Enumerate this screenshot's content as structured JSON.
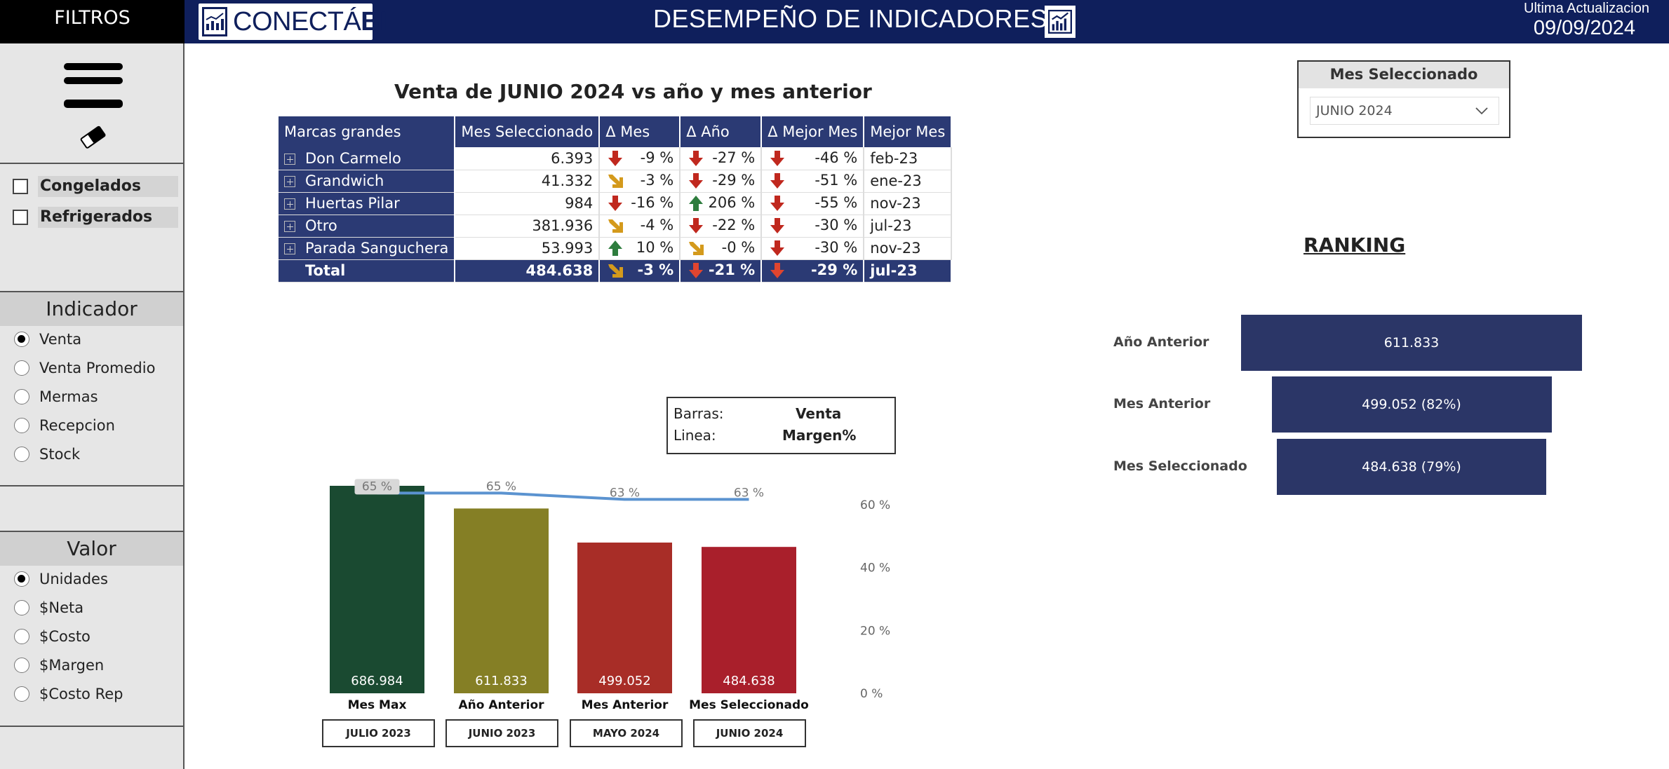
{
  "sidebar": {
    "header": "FILTROS",
    "checkboxes": [
      {
        "label": "Congelados",
        "checked": false
      },
      {
        "label": "Refrigerados",
        "checked": false
      }
    ],
    "indicador": {
      "title": "Indicador",
      "options": [
        "Venta",
        "Venta Promedio",
        "Mermas",
        "Recepcion",
        "Stock"
      ],
      "selected": "Venta"
    },
    "valor": {
      "title": "Valor",
      "options": [
        "Unidades",
        "$Neta",
        "$Costo",
        "$Margen",
        "$Costo Rep"
      ],
      "selected": "Unidades"
    }
  },
  "header": {
    "logo_text_light": "CONECTÁ",
    "logo_text_bold": "BI",
    "title": "DESEMPEÑO DE INDICADORES",
    "update_label": "Ultima Actualizacion",
    "update_date": "09/09/2024"
  },
  "table": {
    "title": "Venta de JUNIO 2024 vs año y mes anterior",
    "columns": [
      "Marcas grandes",
      "Mes Seleccionado",
      "Δ Mes",
      "Δ Año",
      "Δ Mejor Mes",
      "Mejor Mes"
    ],
    "rows": [
      {
        "brand": "Don Carmelo",
        "mes": "6.393",
        "d_mes": "-9 %",
        "d_mes_icon": "down",
        "d_ano": "-27 %",
        "d_ano_icon": "down",
        "d_mejor": "-46 %",
        "d_mejor_icon": "down",
        "mejor_mes": "feb-23"
      },
      {
        "brand": "Grandwich",
        "mes": "41.332",
        "d_mes": "-3 %",
        "d_mes_icon": "diag",
        "d_ano": "-29 %",
        "d_ano_icon": "down",
        "d_mejor": "-51 %",
        "d_mejor_icon": "down",
        "mejor_mes": "ene-23"
      },
      {
        "brand": "Huertas Pilar",
        "mes": "984",
        "d_mes": "-16 %",
        "d_mes_icon": "down",
        "d_ano": "206 %",
        "d_ano_icon": "up",
        "d_mejor": "-55 %",
        "d_mejor_icon": "down",
        "mejor_mes": "nov-23"
      },
      {
        "brand": "Otro",
        "mes": "381.936",
        "d_mes": "-4 %",
        "d_mes_icon": "diag",
        "d_ano": "-22 %",
        "d_ano_icon": "down",
        "d_mejor": "-30 %",
        "d_mejor_icon": "down",
        "mejor_mes": "jul-23"
      },
      {
        "brand": "Parada Sanguchera",
        "mes": "53.993",
        "d_mes": "10 %",
        "d_mes_icon": "up",
        "d_ano": "-0 %",
        "d_ano_icon": "diag",
        "d_mejor": "-30 %",
        "d_mejor_icon": "down",
        "mejor_mes": "nov-23"
      }
    ],
    "total": {
      "brand": "Total",
      "mes": "484.638",
      "d_mes": "-3 %",
      "d_mes_icon": "diag",
      "d_ano": "-21 %",
      "d_ano_icon": "down_light",
      "d_mejor": "-29 %",
      "d_mejor_icon": "down_light",
      "mejor_mes": "jul-23"
    }
  },
  "icon_colors": {
    "down": "#c0281e",
    "up": "#2e7d3e",
    "diag": "#d49a1c",
    "down_light": "#e0452f"
  },
  "mes_selector": {
    "title": "Mes Seleccionado",
    "value": "JUNIO 2024"
  },
  "ranking": {
    "title": "RANKING",
    "items": [
      {
        "label": "Año Anterior",
        "value": "611.833",
        "share": 1.0
      },
      {
        "label": "Mes Anterior",
        "value": "499.052 (82%)",
        "share": 0.82
      },
      {
        "label": "Mes Seleccionado",
        "value": "484.638 (79%)",
        "share": 0.79
      }
    ],
    "bar_color": "#2b3667"
  },
  "legend": {
    "barras_label": "Barras:",
    "barras_value": "Venta",
    "linea_label": "Linea:",
    "linea_value": "Margen%"
  },
  "chart_data": {
    "type": "bar",
    "categories": [
      "Mes Max",
      "Año Anterior",
      "Mes Anterior",
      "Mes Seleccionado"
    ],
    "series": [
      {
        "values": [
          686984,
          611833,
          499052,
          484638
        ],
        "labels": [
          "686.984",
          "611.833",
          "499.052",
          "484.638"
        ],
        "colors": [
          "#1a4a31",
          "#857f25",
          "#a82d27",
          "#a91f2b"
        ]
      },
      {
        "values": [
          65,
          65,
          63,
          63
        ],
        "labels": [
          "65 %",
          "65 %",
          "63 %",
          "63 %"
        ],
        "color": "#5b93d0",
        "axis": "right"
      }
    ],
    "bar_ylim": [
      0,
      700000
    ],
    "y2ticks": [
      "60 %",
      "40 %",
      "20 %",
      "0 %"
    ],
    "y2lim": [
      0,
      70
    ],
    "months": [
      "JULIO 2023",
      "JUNIO 2023",
      "MAYO 2024",
      "JUNIO 2024"
    ]
  }
}
